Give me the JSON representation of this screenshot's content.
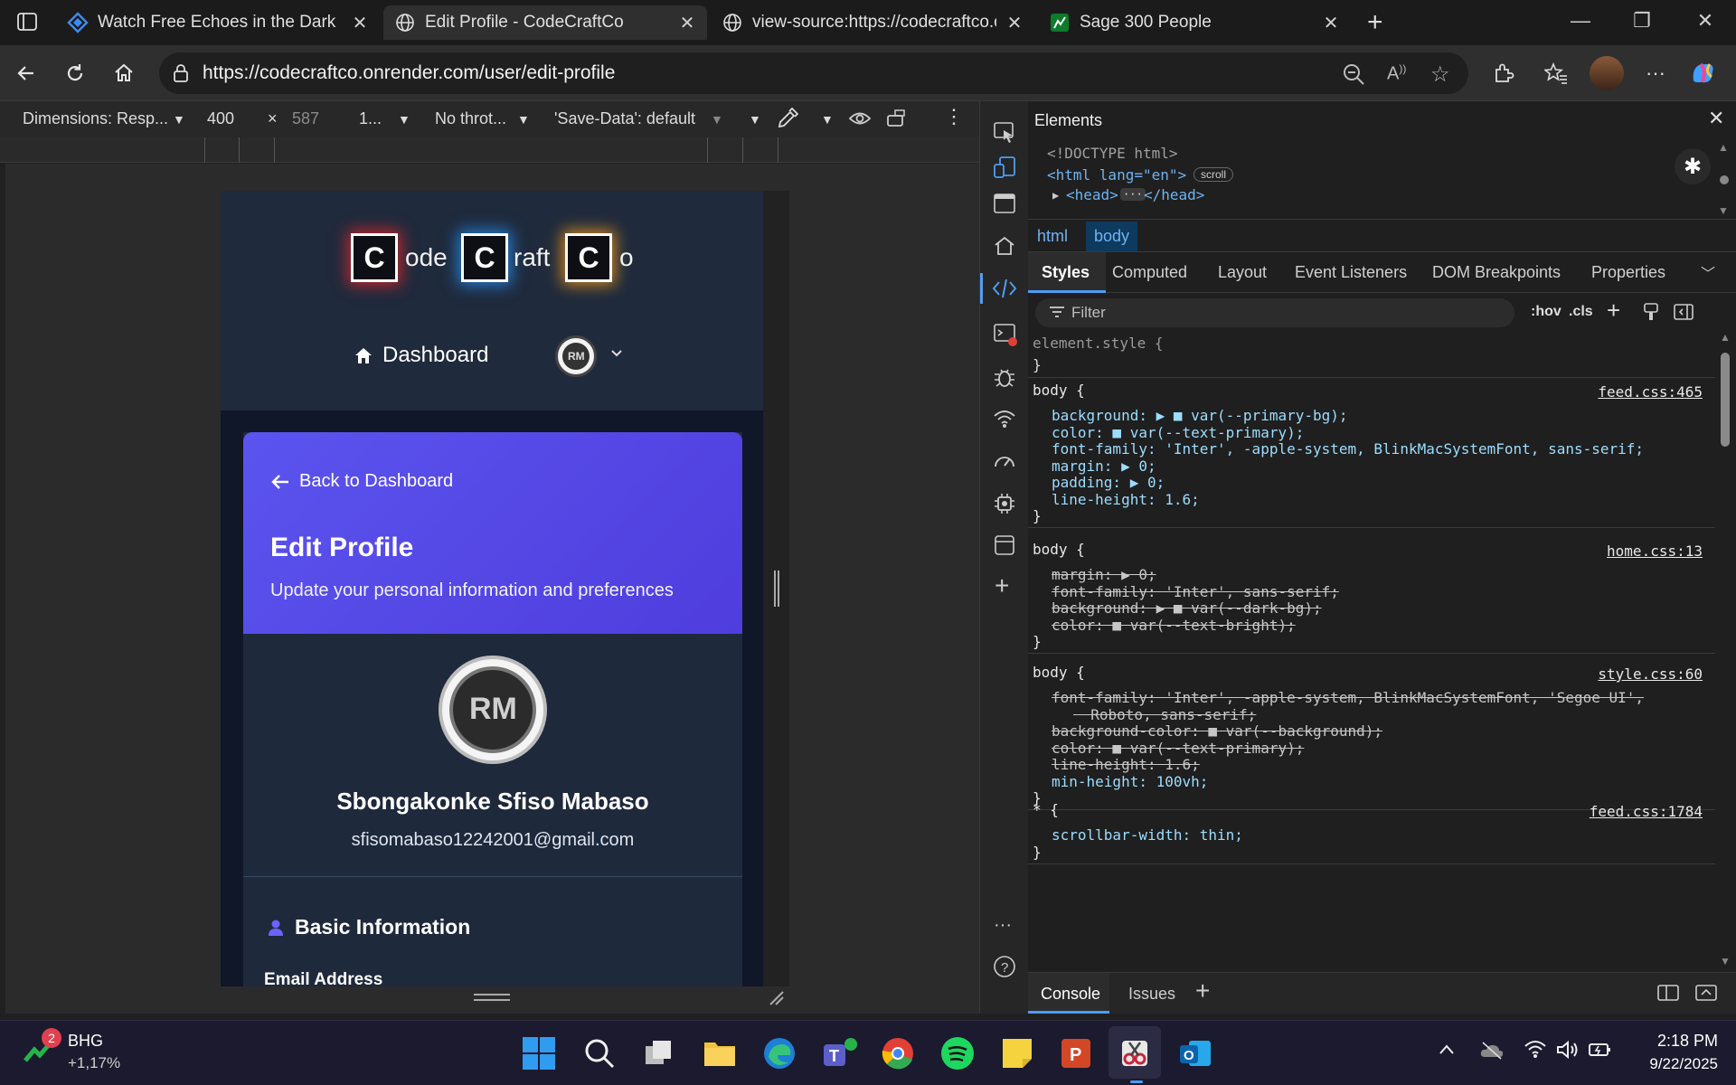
{
  "tabs": [
    {
      "title": "Watch Free Echoes in the Dark Fu",
      "icon": "diamond-icon"
    },
    {
      "title": "Edit Profile - CodeCraftCo",
      "icon": "globe-icon"
    },
    {
      "title": "view-source:https://codecraftco.o",
      "icon": "globe-icon"
    },
    {
      "title": "Sage 300 People",
      "icon": "sage-icon"
    }
  ],
  "address": {
    "url": "https://codecraftco.onrender.com/user/edit-profile"
  },
  "device_toolbar": {
    "dimensions": "Dimensions: Resp...",
    "width": "400",
    "times": "×",
    "height": "587",
    "dpr": "1...",
    "throttle": "No throt...",
    "savedata": "'Save-Data': default"
  },
  "site": {
    "logo": {
      "c1": "C",
      "t1": "ode",
      "c2": "C",
      "t2": "raft",
      "c3": "C",
      "t3": "o"
    },
    "nav_dashboard": "Dashboard",
    "back_link": "Back to Dashboard",
    "title": "Edit Profile",
    "subtitle": "Update your personal information and preferences",
    "user_name": "Sbongakonke Sfiso Mabaso",
    "user_email": "sfisomabaso12242001@gmail.com",
    "section_title": "Basic Information",
    "field_label": "Email Address"
  },
  "devtools": {
    "panel_title": "Elements",
    "dom": {
      "doctype": "<!DOCTYPE html>",
      "html_open": "<html lang=\"en\">",
      "scroll_badge": "scroll",
      "head": "<head>",
      "head_close": "</head>"
    },
    "breadcrumbs": [
      "html",
      "body"
    ],
    "tabs": [
      "Styles",
      "Computed",
      "Layout",
      "Event Listeners",
      "DOM Breakpoints",
      "Properties"
    ],
    "filter_placeholder": "Filter",
    "hov": ":hov",
    "cls": ".cls",
    "element_style": "element.style {",
    "rules": [
      {
        "selector": "body {",
        "source": "feed.css:465",
        "props": [
          {
            "text": "background: ▶ ■ var(--primary-bg);",
            "struck": false
          },
          {
            "text": "color: ■ var(--text-primary);",
            "struck": false
          },
          {
            "text": "font-family: 'Inter', -apple-system, BlinkMacSystemFont, sans-serif;",
            "struck": false
          },
          {
            "text": "margin: ▶ 0;",
            "struck": false
          },
          {
            "text": "padding: ▶ 0;",
            "struck": false
          },
          {
            "text": "line-height: 1.6;",
            "struck": false
          }
        ]
      },
      {
        "selector": "body {",
        "source": "home.css:13",
        "props": [
          {
            "text": "margin: ▶ 0;",
            "struck": true
          },
          {
            "text": "font-family: 'Inter', sans-serif;",
            "struck": true
          },
          {
            "text": "background: ▶ ■ var(--dark-bg);",
            "struck": true
          },
          {
            "text": "color: ■ var(--text-bright);",
            "struck": true
          }
        ]
      },
      {
        "selector": "body {",
        "source": "style.css:60",
        "props": [
          {
            "text": "font-family: 'Inter', -apple-system, BlinkMacSystemFont, 'Segoe UI',",
            "struck": true
          },
          {
            "text": "  Roboto, sans-serif;",
            "struck": true
          },
          {
            "text": "background-color: ■ var(--background);",
            "struck": true
          },
          {
            "text": "color: ■ var(--text-primary);",
            "struck": true
          },
          {
            "text": "line-height: 1.6;",
            "struck": true
          },
          {
            "text": "min-height: 100vh;",
            "struck": false
          }
        ]
      },
      {
        "selector": "* {",
        "source": "feed.css:1784",
        "props": [
          {
            "text": "scrollbar-width: thin;",
            "struck": false
          }
        ]
      }
    ],
    "drawer_tabs": [
      "Console",
      "Issues"
    ]
  },
  "taskbar": {
    "stock_badge": "2",
    "stock_name": "BHG",
    "stock_change": "+1,17%",
    "time": "2:18 PM",
    "date": "9/22/2025"
  }
}
